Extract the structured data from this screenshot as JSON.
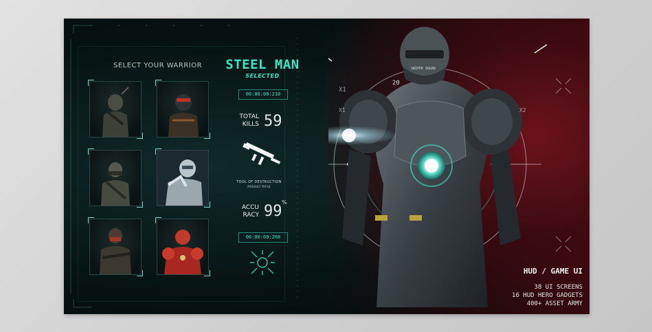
{
  "roster": {
    "heading": "SELECT YOUR WARRIOR",
    "warriors": [
      {
        "name": "warrior-hooded-rifleman"
      },
      {
        "name": "warrior-red-visor"
      },
      {
        "name": "warrior-bandana-soldier"
      },
      {
        "name": "warrior-steel-man"
      },
      {
        "name": "warrior-masked-gunner"
      },
      {
        "name": "warrior-red-armor"
      }
    ]
  },
  "selected": {
    "name": "STEEL MAN",
    "status": "SELECTED",
    "code_top": "00:00:00:210",
    "code_bottom": "00:00:00:208"
  },
  "stats": {
    "kills_label_1": "TOTAL",
    "kills_label_2": "KILLS",
    "kills_value": "59",
    "tool_label": "TOOL OF DESTRUCTION",
    "tool_sub": "ASSAULT RIFLE",
    "accuracy_label_1": "ACCU",
    "accuracy_label_2": "RACY",
    "accuracy_value": "99",
    "accuracy_unit": "%"
  },
  "hud": {
    "markers": [
      "X1",
      "X1",
      "X2"
    ],
    "helmet_text": "SNIPER SQUAD",
    "shoulder_number": "20"
  },
  "promo": {
    "title_left": "HUD",
    "title_sep": "/",
    "title_right": "GAME UI",
    "lines": [
      "38 UI SCREENS",
      "16 HUD HERO GADGETS",
      "400+ ASSET ARMY"
    ]
  },
  "colors": {
    "accent": "#3be3c4",
    "panel_bg": "#071414",
    "red_glow": "#7a1420",
    "page_bg": "#d6d6d6"
  }
}
